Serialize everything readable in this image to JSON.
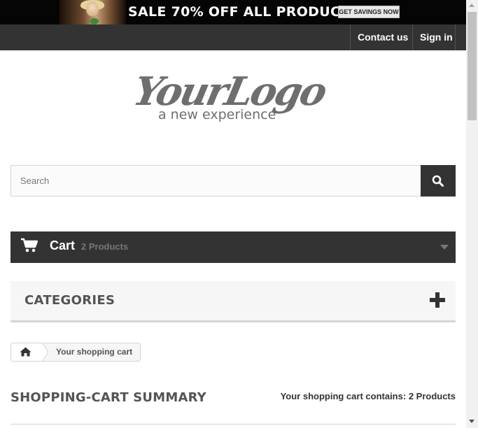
{
  "banner": {
    "text": "SALE 70% OFF ALL PRODUCTS",
    "button_label": "GET SAVINGS NOW"
  },
  "nav": {
    "contact_label": "Contact us",
    "signin_label": "Sign in"
  },
  "logo": {
    "brand_text": "YourLogo",
    "tagline": "a new experience"
  },
  "search": {
    "placeholder": "Search",
    "value": "",
    "button_icon": "search-icon"
  },
  "cart": {
    "label": "Cart",
    "count_text": "2 Products",
    "icon": "shopping-cart-icon"
  },
  "categories": {
    "title": "CATEGORIES",
    "icon": "plus-icon"
  },
  "breadcrumb": {
    "home_icon": "home-icon",
    "current": "Your shopping cart"
  },
  "summary": {
    "title": "SHOPPING-CART SUMMARY",
    "count_prefix": "Your shopping cart contains:",
    "count_text": "2 Products"
  },
  "colors": {
    "dark": "#333333",
    "light_bg": "#f6f6f6",
    "border": "#d6d4d4",
    "muted_text": "#777777",
    "heading_text": "#555454"
  }
}
